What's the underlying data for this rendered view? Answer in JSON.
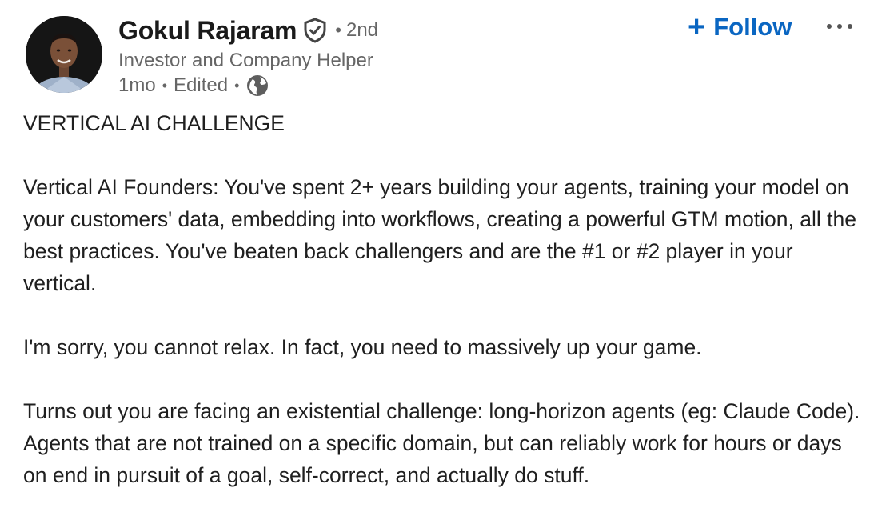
{
  "author": {
    "name": "Gokul Rajaram",
    "verified_icon": "verified-shield-icon",
    "degree": "2nd",
    "headline": "Investor and Company Helper",
    "time": "1mo",
    "edited": "Edited",
    "visibility_icon": "globe-icon"
  },
  "actions": {
    "follow_label": "Follow",
    "follow_icon": "plus-icon",
    "more_icon": "ellipsis-icon"
  },
  "colors": {
    "accent": "#0a66c2",
    "secondary_text": "#666666",
    "body_text": "#1f1f1f"
  },
  "post": {
    "paragraphs": [
      "VERTICAL AI CHALLENGE",
      "Vertical AI Founders: You've spent 2+ years building your agents, training your model on your customers' data, embedding into workflows, creating a powerful GTM motion, all the best practices. You've beaten back challengers and are the #1 or #2 player in your vertical.",
      "I'm sorry, you cannot relax. In fact, you need to massively up your game.",
      "Turns out you are facing an existential challenge: long-horizon agents (eg: Claude Code). Agents that are not trained on a specific domain, but can reliably work for hours or days on end in pursuit of a goal, self-correct, and actually do stuff."
    ]
  }
}
